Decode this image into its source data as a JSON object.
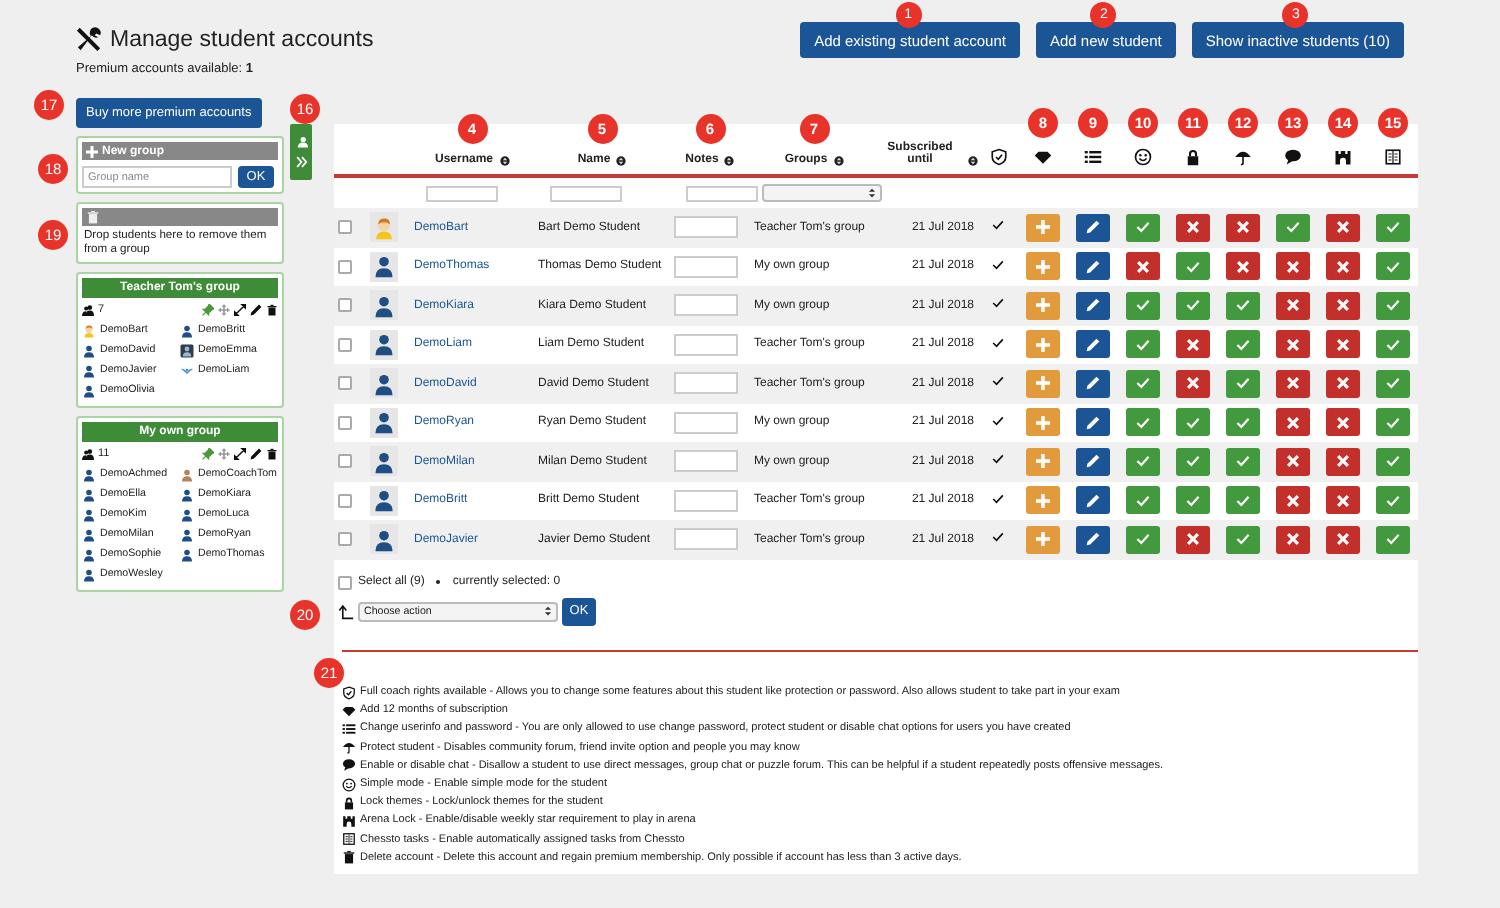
{
  "page": {
    "title": "Manage student accounts",
    "premium_label": "Premium accounts available:",
    "premium_count": "1"
  },
  "top_buttons": [
    {
      "label": "Add existing student account",
      "badge": "1"
    },
    {
      "label": "Add new student",
      "badge": "2"
    },
    {
      "label": "Show inactive students (10)",
      "badge": "3"
    }
  ],
  "buy_button": {
    "label": "Buy more premium accounts",
    "badge": "17"
  },
  "sidebar_toggle": {
    "badge": "16"
  },
  "new_group": {
    "title": "New group",
    "placeholder": "Group name",
    "ok": "OK",
    "badge": "18"
  },
  "drop_zone": {
    "text": "Drop students here to remove them from a group",
    "badge": "19"
  },
  "groups": [
    {
      "name": "Teacher Tom's group",
      "count": "7",
      "members": [
        {
          "name": "DemoBart",
          "kind": "cartoon"
        },
        {
          "name": "DemoBritt",
          "kind": "person"
        },
        {
          "name": "DemoDavid",
          "kind": "person"
        },
        {
          "name": "DemoEmma",
          "kind": "framed"
        },
        {
          "name": "DemoJavier",
          "kind": "person"
        },
        {
          "name": "DemoLiam",
          "kind": "bird"
        },
        {
          "name": "DemoOlivia",
          "kind": "person"
        }
      ]
    },
    {
      "name": "My own group",
      "count": "11",
      "members": [
        {
          "name": "DemoAchmed",
          "kind": "person"
        },
        {
          "name": "DemoCoachTom",
          "kind": "coach"
        },
        {
          "name": "DemoElla",
          "kind": "person"
        },
        {
          "name": "DemoKiara",
          "kind": "person"
        },
        {
          "name": "DemoKim",
          "kind": "person"
        },
        {
          "name": "DemoLuca",
          "kind": "person"
        },
        {
          "name": "DemoMilan",
          "kind": "person"
        },
        {
          "name": "DemoRyan",
          "kind": "person"
        },
        {
          "name": "DemoSophie",
          "kind": "person"
        },
        {
          "name": "DemoThomas",
          "kind": "person"
        },
        {
          "name": "DemoWesley",
          "kind": "person"
        }
      ]
    }
  ],
  "table": {
    "text_columns": [
      {
        "label": "Username",
        "badge": "4"
      },
      {
        "label": "Name",
        "badge": "5"
      },
      {
        "label": "Notes",
        "badge": "6"
      },
      {
        "label": "Groups",
        "badge": "7"
      },
      {
        "label": "Subscribed until"
      }
    ],
    "icon_columns": [
      {
        "kind": "coach"
      },
      {
        "kind": "subscription",
        "badge": "8"
      },
      {
        "kind": "userinfo",
        "badge": "9"
      },
      {
        "kind": "simple",
        "badge": "10"
      },
      {
        "kind": "lock",
        "badge": "11"
      },
      {
        "kind": "protect",
        "badge": "12"
      },
      {
        "kind": "chat",
        "badge": "13"
      },
      {
        "kind": "arena",
        "badge": "14"
      },
      {
        "kind": "tasks",
        "badge": "15"
      }
    ],
    "rows": [
      {
        "selected": false,
        "avatar": {
          "kind": "cartoon"
        },
        "username": "DemoBart",
        "name": "Bart Demo Student",
        "group": "Teacher Tom's group",
        "subscribed": "21 Jul 2018",
        "coach": true,
        "toggles": [
          true,
          false,
          false,
          true,
          false,
          true
        ]
      },
      {
        "selected": false,
        "avatar": {
          "kind": "person"
        },
        "username": "DemoThomas",
        "name": "Thomas Demo Student",
        "group": "My own group",
        "subscribed": "21 Jul 2018",
        "coach": true,
        "toggles": [
          false,
          true,
          false,
          false,
          false,
          true
        ]
      },
      {
        "selected": false,
        "avatar": {
          "kind": "person"
        },
        "username": "DemoKiara",
        "name": "Kiara Demo Student",
        "group": "My own group",
        "subscribed": "21 Jul 2018",
        "coach": true,
        "toggles": [
          true,
          true,
          true,
          false,
          false,
          true
        ]
      },
      {
        "selected": false,
        "avatar": {
          "kind": "person"
        },
        "username": "DemoLiam",
        "name": "Liam Demo Student",
        "group": "Teacher Tom's group",
        "subscribed": "21 Jul 2018",
        "coach": true,
        "toggles": [
          true,
          false,
          true,
          false,
          false,
          true
        ]
      },
      {
        "selected": false,
        "avatar": {
          "kind": "person"
        },
        "username": "DemoDavid",
        "name": "David Demo Student",
        "group": "Teacher Tom's group",
        "subscribed": "21 Jul 2018",
        "coach": true,
        "toggles": [
          true,
          false,
          true,
          false,
          false,
          true
        ]
      },
      {
        "selected": false,
        "avatar": {
          "kind": "person"
        },
        "username": "DemoRyan",
        "name": "Ryan Demo Student",
        "group": "My own group",
        "subscribed": "21 Jul 2018",
        "coach": true,
        "toggles": [
          true,
          true,
          true,
          false,
          false,
          true
        ]
      },
      {
        "selected": false,
        "avatar": {
          "kind": "person"
        },
        "username": "DemoMilan",
        "name": "Milan Demo Student",
        "group": "My own group",
        "subscribed": "21 Jul 2018",
        "coach": true,
        "toggles": [
          true,
          true,
          true,
          false,
          false,
          true
        ]
      },
      {
        "selected": false,
        "avatar": {
          "kind": "person"
        },
        "username": "DemoBritt",
        "name": "Britt Demo Student",
        "group": "Teacher Tom's group",
        "subscribed": "21 Jul 2018",
        "coach": true,
        "toggles": [
          true,
          true,
          true,
          false,
          false,
          true
        ]
      },
      {
        "selected": false,
        "avatar": {
          "kind": "person"
        },
        "username": "DemoJavier",
        "name": "Javier Demo Student",
        "group": "Teacher Tom's group",
        "subscribed": "21 Jul 2018",
        "coach": true,
        "toggles": [
          true,
          false,
          true,
          false,
          false,
          true
        ]
      }
    ]
  },
  "footer": {
    "select_all": {
      "label": "Select all (9)",
      "checked": false
    },
    "selected_count": "currently selected: 0",
    "action": "Choose action",
    "ok": "OK",
    "badge": "20"
  },
  "legend": {
    "badge": "21",
    "items": [
      {
        "kind": "coach",
        "text": "Full coach rights available - Allows you to change some features about this student like protection or password. Also allows student to take part in your exam"
      },
      {
        "kind": "subscription",
        "text": "Add 12 months of subscription"
      },
      {
        "kind": "userinfo",
        "text": "Change userinfo and password - You are only allowed to use change password, protect student or disable chat options for users you have created"
      },
      {
        "kind": "protect",
        "text": "Protect student - Disables community forum, friend invite option and people you may know"
      },
      {
        "kind": "chat",
        "text": "Enable or disable chat - Disallow a student to use direct messages, group chat or puzzle forum. This can be helpful if a student repeatedly posts offensive messages."
      },
      {
        "kind": "simple",
        "text": "Simple mode - Enable simple mode for the student"
      },
      {
        "kind": "lock",
        "text": "Lock themes - Lock/unlock themes for the student"
      },
      {
        "kind": "arena",
        "text": "Arena Lock - Enable/disable weekly star requirement to play in arena"
      },
      {
        "kind": "tasks",
        "text": "Chessto tasks - Enable automatically assigned tasks from Chessto"
      },
      {
        "kind": "delete",
        "text": "Delete account - Delete this account and regain premium membership. Only possible if account has less than 3 active days."
      }
    ]
  }
}
